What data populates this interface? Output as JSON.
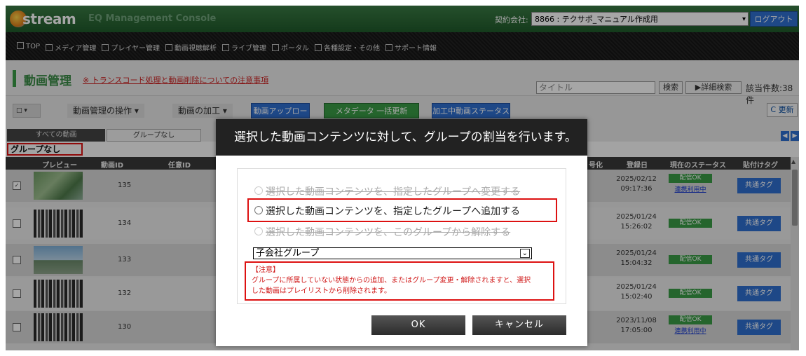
{
  "header": {
    "logo_text": "stream",
    "app_title": "EQ Management Console",
    "company_label": "契約会社:",
    "company_value": "8866 : テクサポ_マニュアル作成用",
    "logout": "ログアウト"
  },
  "nav": [
    "TOP",
    "メディア管理",
    "プレイヤー管理",
    "動画視聴解析",
    "ライブ管理",
    "ポータル",
    "各種設定・その他",
    "サポート情報"
  ],
  "page": {
    "title": "動画管理",
    "notice": "※ トランスコード処理と動画削除についての注意事項",
    "search_placeholder": "タイトル",
    "search_button": "検索",
    "advanced_button": "▶詳細検索",
    "count": "該当件数:38件"
  },
  "toolbar": {
    "select": "□ ▾",
    "ops": "動画管理の操作 ▾",
    "edit": "動画の加工 ▾",
    "upload": "動画アップロード",
    "bulk_meta": "メタデータ 一括更新",
    "processing": "加工中動画ステータス",
    "refresh": "C 更新"
  },
  "tabs": {
    "all": "すべての動画",
    "none": "グループなし",
    "prev": "◀",
    "next": "▶"
  },
  "group_label": "グループなし",
  "table": {
    "headers": {
      "preview": "プレビュー",
      "video_id": "動画ID",
      "any_id": "任意ID",
      "encrypt": "号化",
      "registered": "登録日",
      "status": "現在のステータス",
      "tags": "貼付けタグ"
    },
    "rows": [
      {
        "checked": "✓",
        "id": "135",
        "date": "2025/02/12",
        "time": "09:17:36",
        "status": "配信OK",
        "link": "連携利用中",
        "tag": "共通タグ"
      },
      {
        "checked": "",
        "id": "134",
        "date": "2025/01/24",
        "time": "15:26:02",
        "status": "配信OK",
        "link": "",
        "tag": "共通タグ"
      },
      {
        "checked": "",
        "id": "133",
        "date": "2025/01/24",
        "time": "15:04:32",
        "status": "配信OK",
        "link": "",
        "tag": "共通タグ"
      },
      {
        "checked": "",
        "id": "132",
        "date": "2025/01/24",
        "time": "15:02:40",
        "status": "配信OK",
        "link": "",
        "tag": "共通タグ"
      },
      {
        "checked": "",
        "id": "130",
        "date": "2023/11/08",
        "time": "17:05:00",
        "status": "配信OK",
        "link": "連携利用中",
        "tag": "共通タグ"
      }
    ]
  },
  "modal": {
    "title": "選択した動画コンテンツに対して、グループの割当を行います。",
    "option_change": "選択した動画コンテンツを、指定したグループへ変更する",
    "option_add": "選択した動画コンテンツを、指定したグループへ追加する",
    "option_remove": "選択した動画コンテンツを、このグループから解除する",
    "group_value": "子会社グループ",
    "caution_title": "【注意】",
    "caution_line1": "グループに所属していない状態からの追加、またはグループ変更・解除されますと、選択",
    "caution_line2": "した動画はプレイリストから削除されます。",
    "ok": "OK",
    "cancel": "キャンセル"
  }
}
